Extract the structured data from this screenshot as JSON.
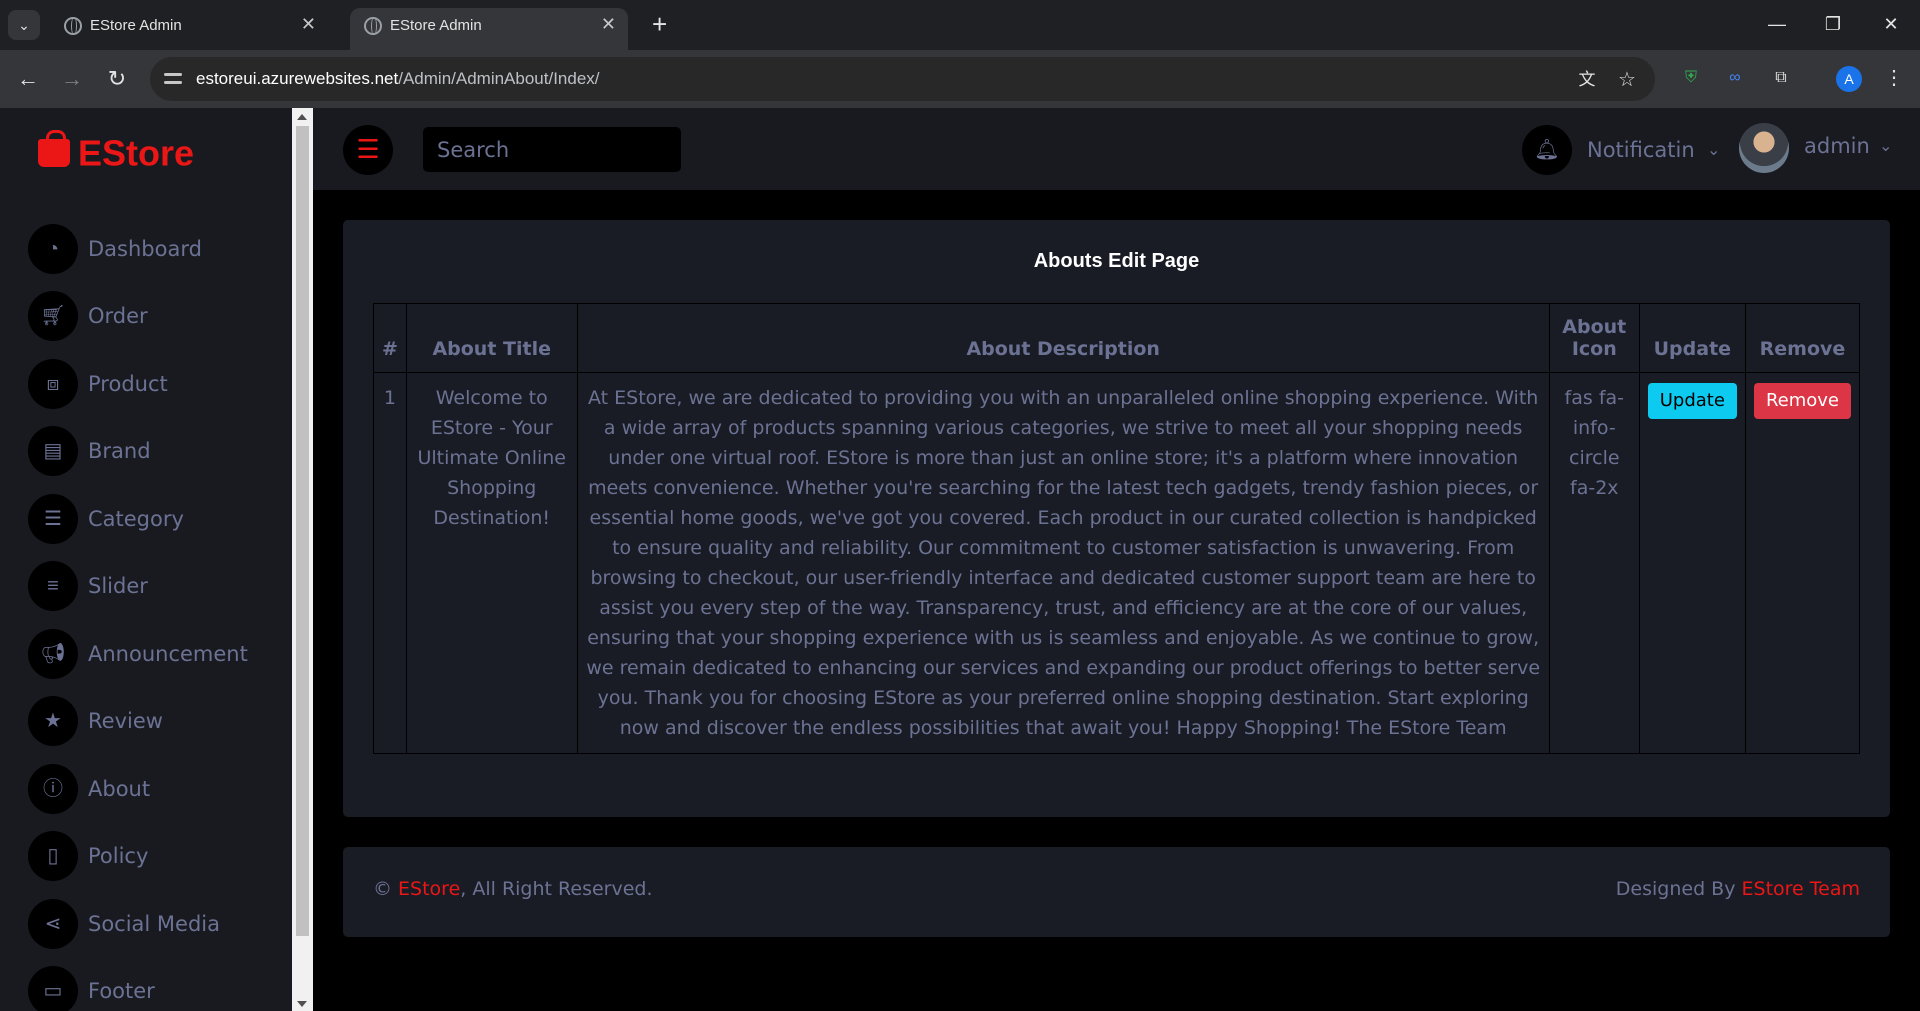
{
  "browser": {
    "tabs": [
      {
        "title": "EStore Admin"
      },
      {
        "title": "EStore Admin"
      }
    ],
    "url_host": "estoreui.azurewebsites.net",
    "url_path": "/Admin/AdminAbout/Index/",
    "profile_initial": "A"
  },
  "sidebar": {
    "brand": "EStore",
    "items": [
      {
        "label": "Dashboard",
        "icon": "gauge-icon"
      },
      {
        "label": "Order",
        "icon": "cart-icon"
      },
      {
        "label": "Product",
        "icon": "cubes-icon"
      },
      {
        "label": "Brand",
        "icon": "book-icon"
      },
      {
        "label": "Category",
        "icon": "list-icon"
      },
      {
        "label": "Slider",
        "icon": "sliders-icon"
      },
      {
        "label": "Announcement",
        "icon": "megaphone-icon"
      },
      {
        "label": "Review",
        "icon": "star-icon"
      },
      {
        "label": "About",
        "icon": "info-icon"
      },
      {
        "label": "Policy",
        "icon": "file-icon"
      },
      {
        "label": "Social Media",
        "icon": "share-icon"
      },
      {
        "label": "Footer",
        "icon": "id-card-icon"
      }
    ]
  },
  "topbar": {
    "search_placeholder": "Search",
    "notification_label": "Notificatin",
    "user_label": "admin"
  },
  "page": {
    "title": "Abouts Edit Page",
    "table": {
      "headers": [
        "#",
        "About Title",
        "About Description",
        "About Icon",
        "Update",
        "Remove"
      ],
      "rows": [
        {
          "index": "1",
          "title": "Welcome to EStore - Your Ultimate Online Shopping Destination!",
          "description": "At EStore, we are dedicated to providing you with an unparalleled online shopping experience. With a wide array of products spanning various categories, we strive to meet all your shopping needs under one virtual roof. EStore is more than just an online store; it's a platform where innovation meets convenience. Whether you're searching for the latest tech gadgets, trendy fashion pieces, or essential home goods, we've got you covered. Each product in our curated collection is handpicked to ensure quality and reliability. Our commitment to customer satisfaction is unwavering. From browsing to checkout, our user-friendly interface and dedicated customer support team are here to assist you every step of the way. Transparency, trust, and efficiency are at the core of our values, ensuring that your shopping experience with us is seamless and enjoyable. As we continue to grow, we remain dedicated to enhancing our services and expanding our product offerings to better serve you. Thank you for choosing EStore as your preferred online shopping destination. Start exploring now and discover the endless possibilities that await you! Happy Shopping! The EStore Team",
          "icon": "fas fa-info-circle fa-2x",
          "update_label": "Update",
          "remove_label": "Remove"
        }
      ]
    }
  },
  "footer": {
    "copyright_symbol": "©",
    "brand": "EStore",
    "rights": ", All Right Reserved.",
    "designed_by": "Designed By",
    "team": "EStore Team"
  },
  "colors": {
    "accent": "#eb1616",
    "panel": "#191c24",
    "text_muted": "#6c7293",
    "update_button": "#0dcaf0",
    "remove_button": "#dc3545"
  }
}
